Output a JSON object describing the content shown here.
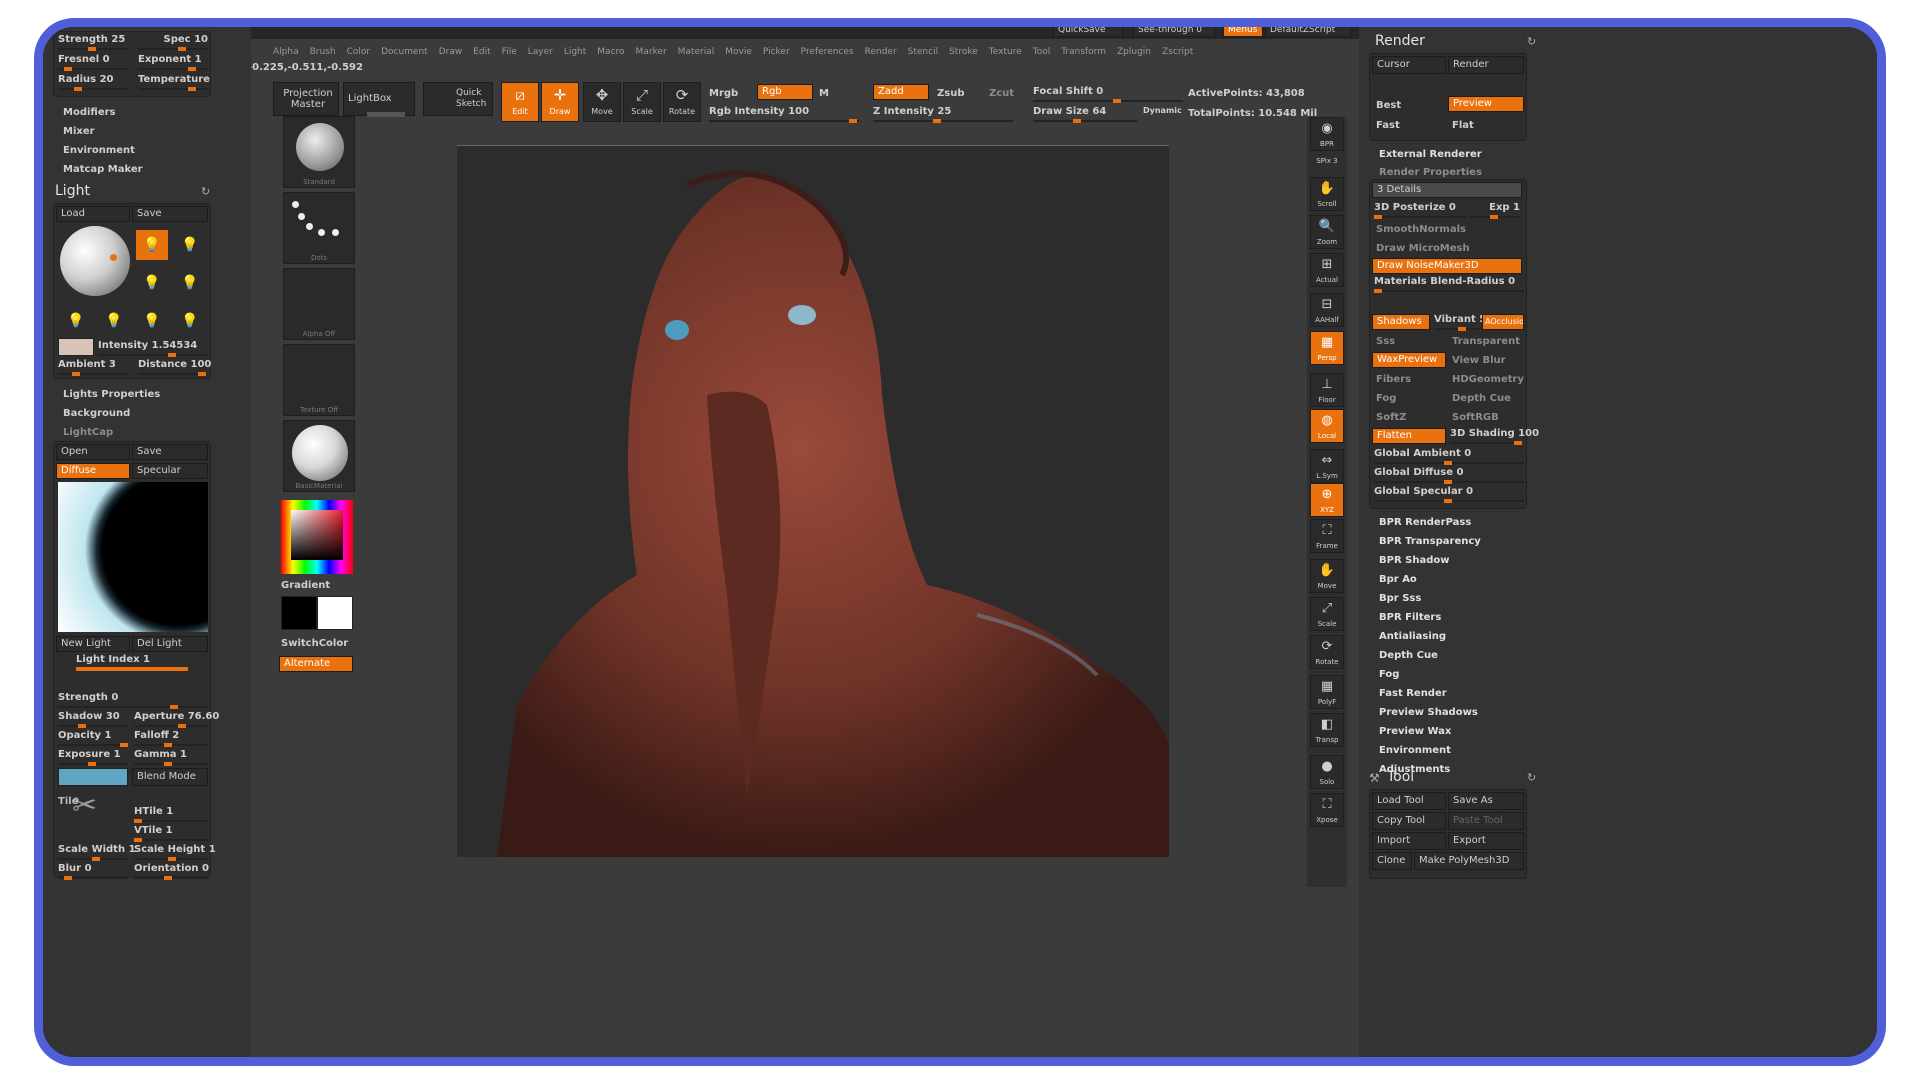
{
  "top": {
    "quicksave": "QuickSave",
    "see_through": "See-through 0",
    "menus": "Menus",
    "default_script": "DefaultZScript"
  },
  "menubar": [
    "Alpha",
    "Brush",
    "Color",
    "Document",
    "Draw",
    "Edit",
    "File",
    "Layer",
    "Light",
    "Macro",
    "Marker",
    "Material",
    "Movie",
    "Picker",
    "Preferences",
    "Render",
    "Stencil",
    "Stroke",
    "Texture",
    "Tool",
    "Transform",
    "Zplugin",
    "Zscript"
  ],
  "coords": "-0.225,-0.511,-0.592",
  "shelf": {
    "projection_master": "Projection Master",
    "lightbox": "LightBox",
    "quick_sketch": "Quick Sketch",
    "edit": "Edit",
    "draw": "Draw",
    "move": "Move",
    "scale": "Scale",
    "rotate": "Rotate",
    "mrgb": "Mrgb",
    "rgb": "Rgb",
    "m": "M",
    "zadd": "Zadd",
    "zsub": "Zsub",
    "zcut": "Zcut",
    "rgb_intensity": "Rgb Intensity 100",
    "z_intensity": "Z Intensity 25",
    "focal_shift": "Focal Shift 0",
    "draw_size": "Draw Size 64",
    "dynamic": "Dynamic",
    "active_points": "ActivePoints: 43,808",
    "total_points": "TotalPoints: 10.548 Mil"
  },
  "left": {
    "strength": "Strength 25",
    "spec": "Spec 10",
    "fresnel": "Fresnel 0",
    "exponent": "Exponent 1",
    "radius": "Radius 20",
    "temperature": "Temperature",
    "modifiers": "Modifiers",
    "mixer": "Mixer",
    "environment": "Environment",
    "matcap_maker": "Matcap Maker",
    "light_header": "Light",
    "load": "Load",
    "save": "Save",
    "intensity": "Intensity 1.54534",
    "ambient": "Ambient 3",
    "distance": "Distance 100",
    "lights_properties": "Lights Properties",
    "background": "Background",
    "lightcap": "LightCap",
    "open": "Open",
    "save2": "Save",
    "diffuse": "Diffuse",
    "specular": "Specular",
    "new_light": "New Light",
    "del_light": "Del Light",
    "light_index": "Light Index 1",
    "strength2": "Strength 0",
    "shadow": "Shadow 30",
    "aperture": "Aperture 76.60",
    "opacity": "Opacity 1",
    "falloff": "Falloff 2",
    "exposure": "Exposure 1",
    "gamma": "Gamma 1",
    "blend_mode": "Blend Mode",
    "htile": "HTile 1",
    "vtile": "VTile 1",
    "tile_label": "Tile",
    "scale_width": "Scale Width 1",
    "scale_height": "Scale Height 1",
    "blur": "Blur 0",
    "orientation": "Orientation 0"
  },
  "palette": {
    "standard": "Standard",
    "dots": "Dots",
    "alpha_off": "Alpha Off",
    "texture_off": "Texture Off",
    "basic_material": "BasicMaterial",
    "gradient": "Gradient",
    "switch_color": "SwitchColor",
    "alternate": "Alternate"
  },
  "rtools": {
    "bpr": "BPR",
    "spix": "SPix 3",
    "scroll": "Scroll",
    "zoom": "Zoom",
    "actual": "Actual",
    "aahalf": "AAHalf",
    "persp": "Persp",
    "floor": "Floor",
    "local": "Local",
    "lsym": "L.Sym",
    "xyz": "XYZ",
    "frame": "Frame",
    "move": "Move",
    "scale": "Scale",
    "rotate": "Rotate",
    "polyf": "PolyF",
    "transp": "Transp",
    "solo": "Solo",
    "xpose": "Xpose"
  },
  "right": {
    "render_header": "Render",
    "cursor": "Cursor",
    "render": "Render",
    "best": "Best",
    "preview": "Preview",
    "fast": "Fast",
    "flat": "Flat",
    "external_renderer": "External Renderer",
    "render_properties": "Render Properties",
    "details": "3 Details",
    "posterize": "3D Posterize 0",
    "exp": "Exp 1",
    "smooth_normals": "SmoothNormals",
    "draw_micromesh": "Draw MicroMesh",
    "draw_noisemaker": "Draw NoiseMaker3D",
    "materials_blend": "Materials Blend-Radius 0",
    "shadows": "Shadows",
    "vibrant": "Vibrant 50",
    "aocclusion": "AOcclusion",
    "sss": "Sss",
    "transparent": "Transparent",
    "waxpreview": "WaxPreview",
    "view_blur": "View Blur",
    "fibers": "Fibers",
    "hdgeometry": "HDGeometry",
    "fog": "Fog",
    "depth_cue": "Depth Cue",
    "softz": "SoftZ",
    "softrgb": "SoftRGB",
    "flatten": "Flatten",
    "shading": "3D Shading 100",
    "global_ambient": "Global Ambient 0",
    "global_diffuse": "Global Diffuse 0",
    "global_specular": "Global Specular 0",
    "links": [
      "BPR RenderPass",
      "BPR Transparency",
      "BPR Shadow",
      "Bpr Ao",
      "Bpr Sss",
      "BPR Filters",
      "Antialiasing",
      "Depth Cue",
      "Fog",
      "Fast Render",
      "Preview Shadows",
      "Preview Wax",
      "Environment",
      "Adjustments"
    ],
    "tool_header": "Tool",
    "load_tool": "Load Tool",
    "save_as": "Save As",
    "copy_tool": "Copy Tool",
    "paste_tool": "Paste Tool",
    "import": "Import",
    "export": "Export",
    "clone": "Clone",
    "make_polymesh": "Make PolyMesh3D"
  },
  "colors": {
    "accent": "#e9720f",
    "frame": "#4f5fd8",
    "sculpt": "#7a3a2e"
  }
}
